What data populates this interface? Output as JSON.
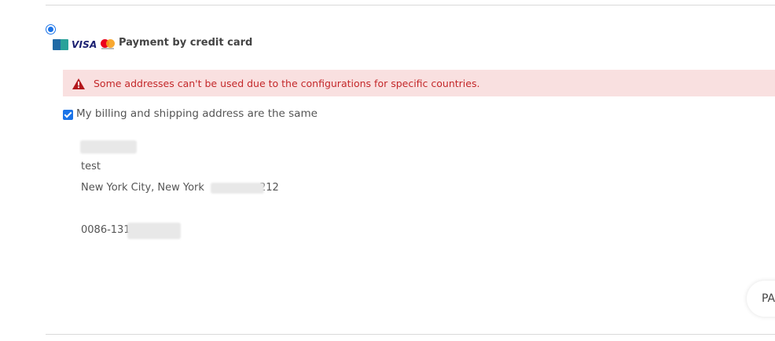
{
  "payment": {
    "option_label": "Payment by credit card",
    "logos": [
      "cb-icon",
      "visa-icon",
      "mastercard-icon"
    ],
    "visa_text": "VISA"
  },
  "alert": {
    "message": "Some addresses can't be used due to the configurations for specific countries.",
    "icon": "warning-icon",
    "color": "#c4282a",
    "background": "#f9e0e0"
  },
  "billing": {
    "same_address_label": "My billing and shipping address are the same",
    "checked": true
  },
  "address": {
    "line1": "test",
    "city_line_prefix": "New York City, New York",
    "city_line_suffix": "212",
    "phone_prefix": "0086-131"
  },
  "floating_button": {
    "label": "PA"
  },
  "colors": {
    "accent": "#1a73e8",
    "alert_text": "#c4282a"
  }
}
